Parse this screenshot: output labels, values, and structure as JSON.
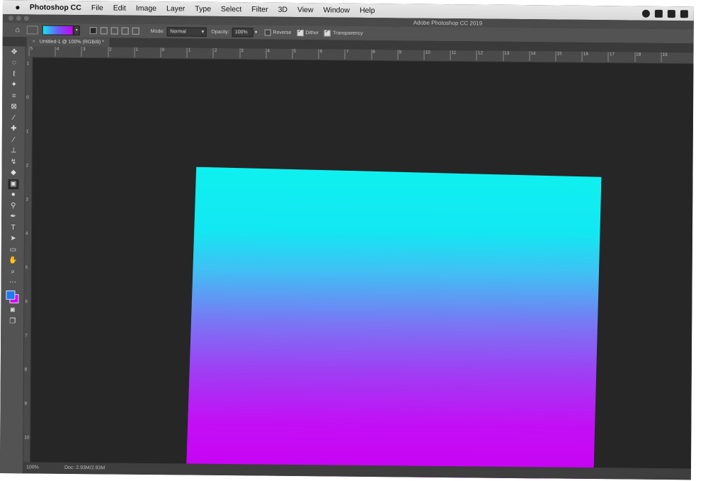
{
  "menubar": {
    "app_name": "Photoshop CC",
    "items": [
      "File",
      "Edit",
      "Image",
      "Layer",
      "Type",
      "Select",
      "Filter",
      "3D",
      "View",
      "Window",
      "Help"
    ]
  },
  "titlebar": {
    "window_title": "Adobe Photoshop CC 2019"
  },
  "options": {
    "mode_label": "Mode:",
    "mode_value": "Normal",
    "opacity_label": "Opacity:",
    "opacity_value": "100%",
    "reverse_label": "Reverse",
    "reverse_checked": false,
    "dither_label": "Dither",
    "dither_checked": true,
    "transparency_label": "Transparency",
    "transparency_checked": true,
    "gradient_colors": [
      "#12e8f2",
      "#c900f5"
    ]
  },
  "document": {
    "tab_title": "Untitled-1 @ 100% (RGB/8) *",
    "close_glyph": "×"
  },
  "rulers": {
    "top": [
      "5",
      "4",
      "3",
      "2",
      "1",
      "0",
      "1",
      "2",
      "3",
      "4",
      "5",
      "6",
      "7",
      "8",
      "9",
      "10",
      "11",
      "12",
      "13",
      "14",
      "15",
      "16",
      "17",
      "18",
      "19"
    ],
    "left": [
      "1",
      "0",
      "1",
      "2",
      "3",
      "4",
      "5",
      "6",
      "7",
      "8",
      "9",
      "10"
    ]
  },
  "tools": [
    "move-tool",
    "marquee-tool",
    "lasso-tool",
    "magic-wand-tool",
    "crop-tool",
    "frame-tool",
    "eyedropper-tool",
    "healing-brush-tool",
    "brush-tool",
    "clone-stamp-tool",
    "history-brush-tool",
    "eraser-tool",
    "gradient-tool",
    "blur-tool",
    "dodge-tool",
    "pen-tool",
    "type-tool",
    "path-selection-tool",
    "rectangle-tool",
    "hand-tool",
    "zoom-tool",
    "more-tools"
  ],
  "swatches": {
    "foreground": "#1a7cf5",
    "background": "#d500f5"
  },
  "canvas": {
    "gradient_top": "#12e8f2",
    "gradient_bottom": "#c900f5"
  },
  "status": {
    "zoom": "100%",
    "doc_info": "Doc: 2.93M/2.93M"
  }
}
